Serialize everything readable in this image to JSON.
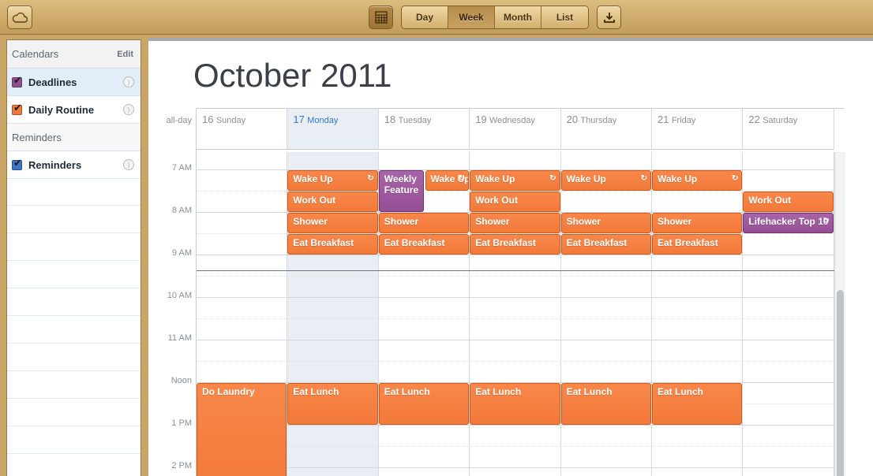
{
  "toolbar": {
    "cloud_icon": "cloud-icon",
    "mini_calendar_icon": "mini-calendar-icon",
    "download_icon": "download-icon",
    "views": [
      "Day",
      "Week",
      "Month",
      "List"
    ],
    "active_view": "Week"
  },
  "sidebar": {
    "calendars_header": "Calendars",
    "edit_label": "Edit",
    "calendars": [
      {
        "label": "Deadlines",
        "color": "#8e4f8f",
        "selected": true
      },
      {
        "label": "Daily Routine",
        "color": "#f07a3b",
        "selected": false
      }
    ],
    "reminders_header": "Reminders",
    "reminders": [
      {
        "label": "Reminders",
        "color": "#3d74c4"
      }
    ]
  },
  "calendar": {
    "title": "October 2011",
    "allday_label": "all-day",
    "days": [
      {
        "num": "16",
        "name": "Sunday"
      },
      {
        "num": "17",
        "name": "Monday",
        "today": true
      },
      {
        "num": "18",
        "name": "Tuesday"
      },
      {
        "num": "19",
        "name": "Wednesday"
      },
      {
        "num": "20",
        "name": "Thursday"
      },
      {
        "num": "21",
        "name": "Friday"
      },
      {
        "num": "22",
        "name": "Saturday"
      }
    ],
    "hours": [
      "7 AM",
      "8 AM",
      "9 AM",
      "10 AM",
      "11 AM",
      "Noon",
      "1 PM",
      "2 PM"
    ],
    "events": [
      {
        "day": 1,
        "start": 7.0,
        "end": 7.5,
        "title": "Wake Up",
        "repeat": true
      },
      {
        "day": 1,
        "start": 7.5,
        "end": 8.0,
        "title": "Work Out"
      },
      {
        "day": 1,
        "start": 8.0,
        "end": 8.5,
        "title": "Shower"
      },
      {
        "day": 1,
        "start": 8.5,
        "end": 9.0,
        "title": "Eat Breakfast"
      },
      {
        "day": 2,
        "start": 7.0,
        "end": 8.0,
        "title": "Weekly Feature",
        "color": "purple",
        "half": "left"
      },
      {
        "day": 2,
        "start": 7.0,
        "end": 7.5,
        "title": "Wake Up",
        "repeat": true,
        "half": "right"
      },
      {
        "day": 2,
        "start": 8.0,
        "end": 8.5,
        "title": "Shower"
      },
      {
        "day": 2,
        "start": 8.5,
        "end": 9.0,
        "title": "Eat Breakfast"
      },
      {
        "day": 3,
        "start": 7.0,
        "end": 7.5,
        "title": "Wake Up",
        "repeat": true
      },
      {
        "day": 3,
        "start": 7.5,
        "end": 8.0,
        "title": "Work Out"
      },
      {
        "day": 3,
        "start": 8.0,
        "end": 8.5,
        "title": "Shower"
      },
      {
        "day": 3,
        "start": 8.5,
        "end": 9.0,
        "title": "Eat Breakfast"
      },
      {
        "day": 4,
        "start": 7.0,
        "end": 7.5,
        "title": "Wake Up",
        "repeat": true
      },
      {
        "day": 4,
        "start": 8.0,
        "end": 8.5,
        "title": "Shower"
      },
      {
        "day": 4,
        "start": 8.5,
        "end": 9.0,
        "title": "Eat Breakfast"
      },
      {
        "day": 5,
        "start": 7.0,
        "end": 7.5,
        "title": "Wake Up",
        "repeat": true
      },
      {
        "day": 5,
        "start": 8.0,
        "end": 8.5,
        "title": "Shower"
      },
      {
        "day": 5,
        "start": 8.5,
        "end": 9.0,
        "title": "Eat Breakfast"
      },
      {
        "day": 6,
        "start": 7.5,
        "end": 8.0,
        "title": "Work Out"
      },
      {
        "day": 6,
        "start": 8.0,
        "end": 8.5,
        "title": "Lifehacker Top 10",
        "color": "purple",
        "repeat": true
      },
      {
        "day": 0,
        "start": 12.0,
        "end": 14.5,
        "title": "Do Laundry"
      },
      {
        "day": 1,
        "start": 12.0,
        "end": 13.0,
        "title": "Eat Lunch"
      },
      {
        "day": 2,
        "start": 12.0,
        "end": 13.0,
        "title": "Eat Lunch"
      },
      {
        "day": 3,
        "start": 12.0,
        "end": 13.0,
        "title": "Eat Lunch"
      },
      {
        "day": 4,
        "start": 12.0,
        "end": 13.0,
        "title": "Eat Lunch"
      },
      {
        "day": 5,
        "start": 12.0,
        "end": 13.0,
        "title": "Eat Lunch"
      }
    ]
  }
}
